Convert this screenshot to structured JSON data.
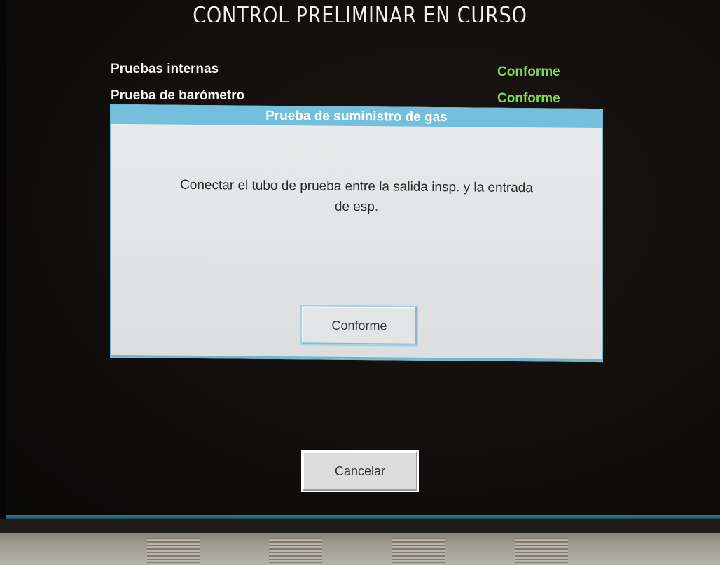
{
  "screen": {
    "title": "CONTROL PRELIMINAR  EN CURSO"
  },
  "tests": [
    {
      "label": "Pruebas internas",
      "status": "Conforme"
    },
    {
      "label": "Prueba de barómetro",
      "status": "Conforme"
    }
  ],
  "dialog": {
    "title": "Prueba de suministro de gas",
    "message_line1": "Conectar el tubo de prueba entre la salida insp. y la entrada",
    "message_line2": "de esp.",
    "ok_label": "Conforme"
  },
  "footer": {
    "cancel_label": "Cancelar"
  },
  "colors": {
    "status_ok": "#7ed957",
    "dialog_accent": "#73bfdc"
  }
}
